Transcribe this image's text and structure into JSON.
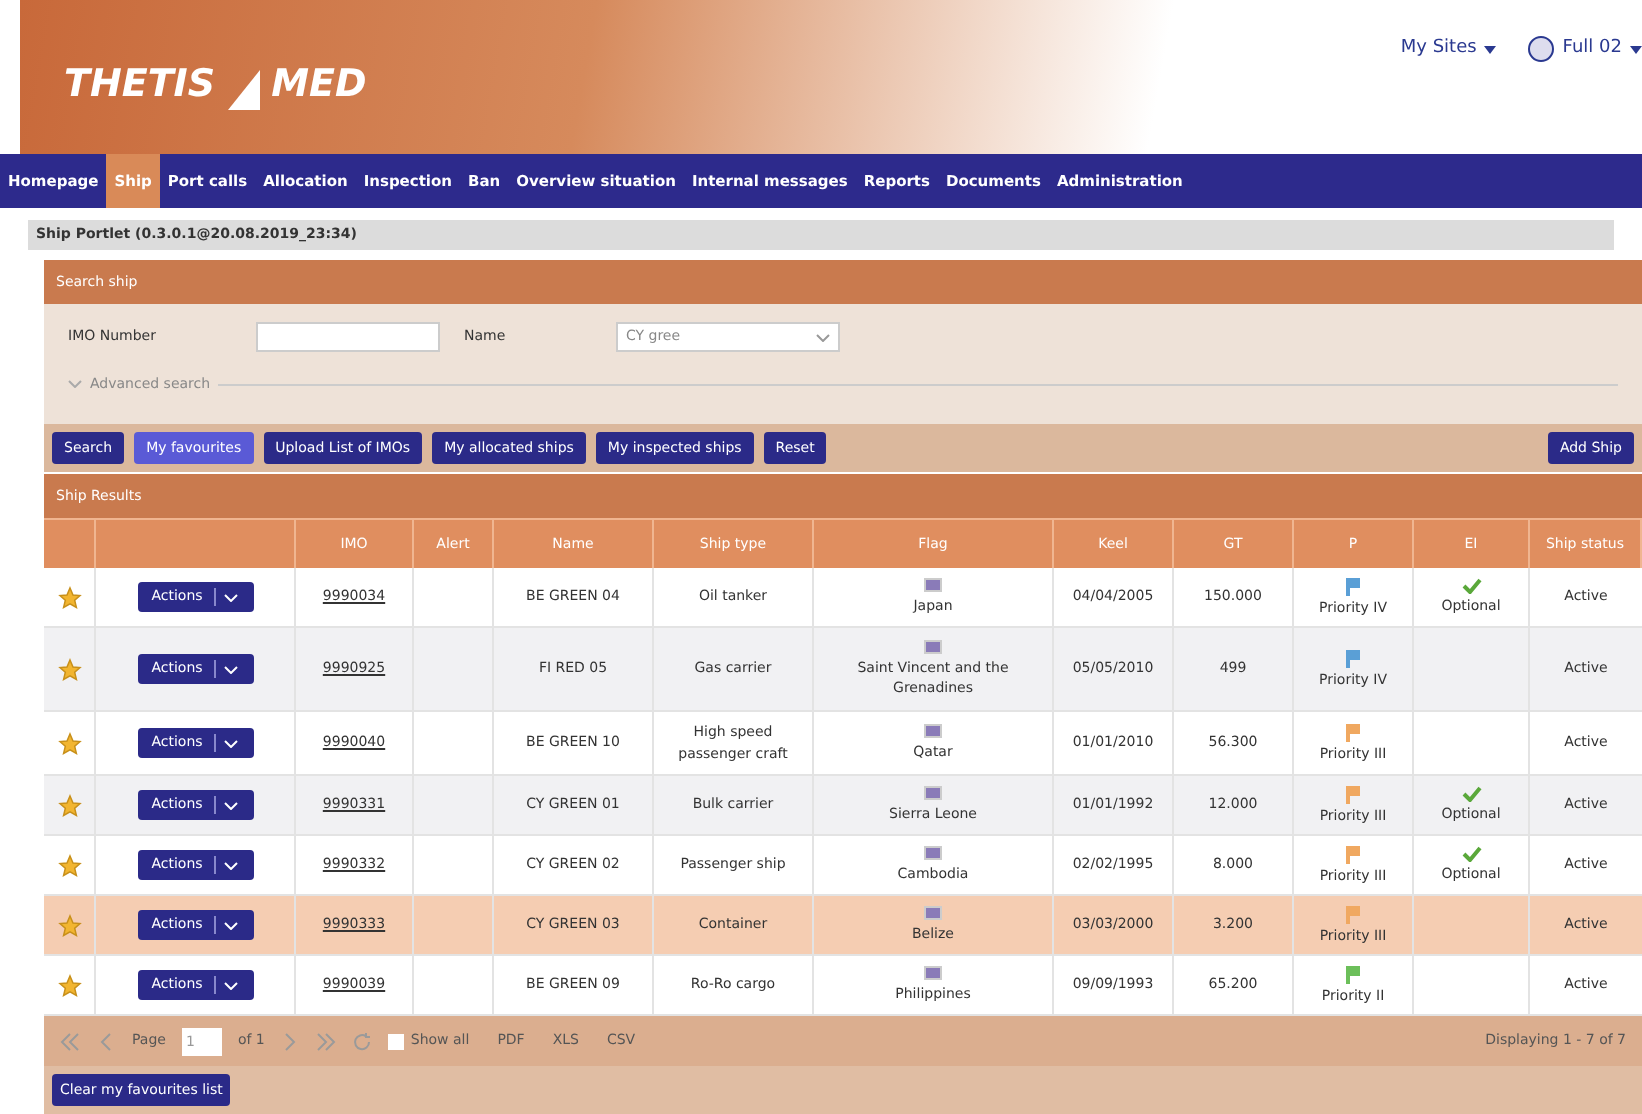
{
  "header": {
    "logo_left": "THETIS",
    "logo_right": "MED",
    "my_sites": "My Sites",
    "user": "Full 02"
  },
  "nav": [
    {
      "label": "Homepage",
      "selected": false
    },
    {
      "label": "Ship",
      "selected": true
    },
    {
      "label": "Port calls",
      "selected": false
    },
    {
      "label": "Allocation",
      "selected": false
    },
    {
      "label": "Inspection",
      "selected": false
    },
    {
      "label": "Ban",
      "selected": false
    },
    {
      "label": "Overview situation",
      "selected": false
    },
    {
      "label": "Internal messages",
      "selected": false
    },
    {
      "label": "Reports",
      "selected": false
    },
    {
      "label": "Documents",
      "selected": false
    },
    {
      "label": "Administration",
      "selected": false
    }
  ],
  "portlet_title": "Ship Portlet (0.3.0.1@20.08.2019_23:34)",
  "search": {
    "title": "Search ship",
    "imo_label": "IMO Number",
    "name_label": "Name",
    "name_value": "CY gree",
    "advanced": "Advanced search"
  },
  "buttons": [
    {
      "label": "Search",
      "selected": false
    },
    {
      "label": "My favourites",
      "selected": true
    },
    {
      "label": "Upload List of IMOs",
      "selected": false
    },
    {
      "label": "My allocated ships",
      "selected": false
    },
    {
      "label": "My inspected ships",
      "selected": false
    },
    {
      "label": "Reset",
      "selected": false
    }
  ],
  "add_ship": "Add Ship",
  "results": {
    "title": "Ship Results",
    "columns": [
      "IMO",
      "Alert",
      "Name",
      "Ship type",
      "Flag",
      "Keel",
      "GT",
      "P",
      "EI",
      "Ship status"
    ],
    "rows": [
      {
        "selected": false,
        "favourite": true,
        "action": "Actions",
        "imo": "9990034",
        "name": "BE GREEN 04",
        "type": "Oil tanker",
        "flag": "Japan",
        "keel": "04/04/2005",
        "gt": "150.000",
        "priority": {
          "label": "Priority IV",
          "color": "#5a9fd6"
        },
        "ei": {
          "checked": true,
          "label": "Optional"
        },
        "status": "Active"
      },
      {
        "selected": false,
        "favourite": true,
        "action": "Actions",
        "imo": "9990925",
        "name": "FI RED 05",
        "type": "Gas carrier",
        "flag": "Saint Vincent and the Grenadines",
        "keel": "05/05/2010",
        "gt": "499",
        "priority": {
          "label": "Priority IV",
          "color": "#5a9fd6"
        },
        "ei": {
          "checked": false
        },
        "status": "Active"
      },
      {
        "selected": false,
        "favourite": true,
        "action": "Actions",
        "imo": "9990040",
        "name": "BE GREEN 10",
        "type": "High speed passenger craft",
        "flag": "Qatar",
        "keel": "01/01/2010",
        "gt": "56.300",
        "priority": {
          "label": "Priority III",
          "color": "#f0a860"
        },
        "ei": {
          "checked": false
        },
        "status": "Active"
      },
      {
        "selected": false,
        "favourite": true,
        "action": "Actions",
        "imo": "9990331",
        "name": "CY GREEN 01",
        "type": "Bulk carrier",
        "flag": "Sierra Leone",
        "keel": "01/01/1992",
        "gt": "12.000",
        "priority": {
          "label": "Priority III",
          "color": "#f0a860"
        },
        "ei": {
          "checked": true,
          "label": "Optional"
        },
        "status": "Active"
      },
      {
        "selected": false,
        "favourite": true,
        "action": "Actions",
        "imo": "9990332",
        "name": "CY GREEN 02",
        "type": "Passenger ship",
        "flag": "Cambodia",
        "keel": "02/02/1995",
        "gt": "8.000",
        "priority": {
          "label": "Priority III",
          "color": "#f0a860"
        },
        "ei": {
          "checked": true,
          "label": "Optional"
        },
        "status": "Active"
      },
      {
        "selected": true,
        "favourite": true,
        "action": "Actions",
        "imo": "9990333",
        "name": "CY GREEN 03",
        "type": "Container",
        "flag": "Belize",
        "keel": "03/03/2000",
        "gt": "3.200",
        "priority": {
          "label": "Priority III",
          "color": "#f0a860"
        },
        "ei": {
          "checked": false
        },
        "status": "Active"
      },
      {
        "selected": false,
        "favourite": true,
        "action": "Actions",
        "imo": "9990039",
        "name": "BE GREEN 09",
        "type": "Ro-Ro cargo",
        "flag": "Philippines",
        "keel": "09/09/1993",
        "gt": "65.200",
        "priority": {
          "label": "Priority II",
          "color": "#6cbf5a"
        },
        "ei": {
          "checked": false
        },
        "status": "Active"
      }
    ]
  },
  "pager": {
    "page_label": "Page",
    "page_value": "1",
    "of": "of 1",
    "show_all": "Show all",
    "show_all_checked": false,
    "exports": [
      "PDF",
      "XLS",
      "CSV"
    ],
    "displaying": "Displaying 1 - 7 of 7"
  },
  "clear_button": "Clear my favourites list"
}
